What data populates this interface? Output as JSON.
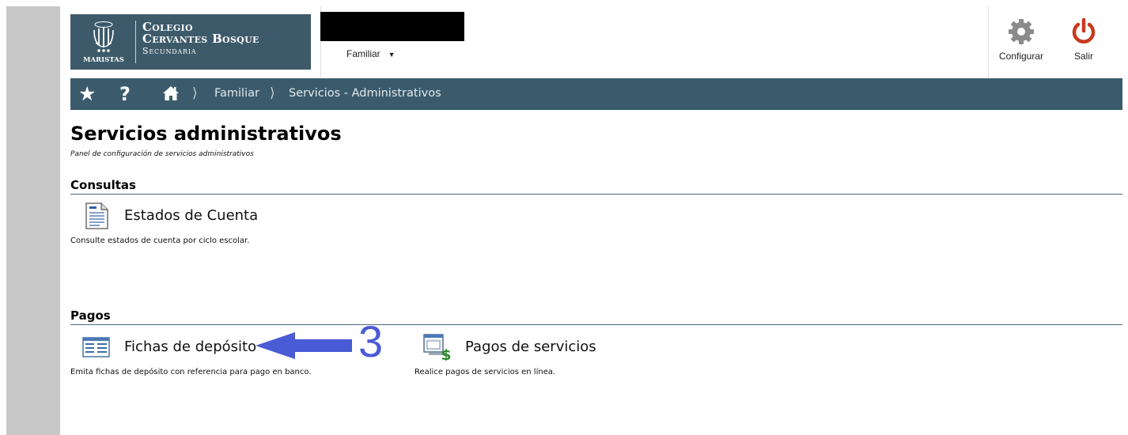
{
  "header": {
    "logo": {
      "line1": "Colegio",
      "line2": "Cervantes Bosque",
      "line3": "Secundaria",
      "emblem_text": "MARISTAS"
    },
    "user_role": "Familiar",
    "configure_label": "Configurar",
    "logout_label": "Salir"
  },
  "nav": {
    "breadcrumb": [
      "Familiar",
      "Servicios - Administrativos"
    ]
  },
  "page": {
    "title": "Servicios administrativos",
    "subtitle": "Panel de configuración de servicios administrativos"
  },
  "sections": {
    "consultas": {
      "label": "Consultas",
      "items": [
        {
          "title": "Estados de Cuenta",
          "description": "Consulte estados de cuenta por ciclo escolar.",
          "icon": "document-icon"
        }
      ]
    },
    "pagos": {
      "label": "Pagos",
      "items": [
        {
          "title": "Fichas de depósito",
          "description": "Emita fichas de depósito con referencia para pago en banco.",
          "icon": "deposit-slip-icon"
        },
        {
          "title": "Pagos de servicios",
          "description": "Realice pagos de servicios en línea.",
          "icon": "online-payment-icon"
        }
      ]
    }
  },
  "annotation": {
    "number": "3",
    "color": "#4a5bd6"
  },
  "colors": {
    "brand": "#3d5a6a",
    "navbar": "#3b5b6c",
    "logout_red": "#c83a1e",
    "gear_grey": "#8a8a8a"
  }
}
